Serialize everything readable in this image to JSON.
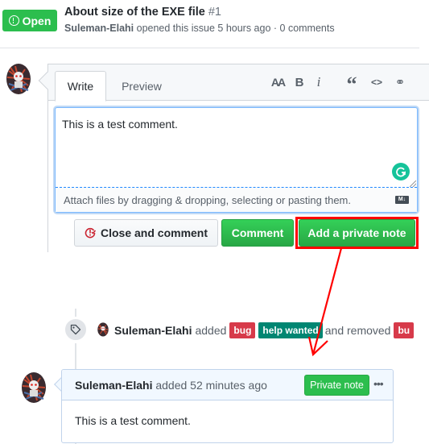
{
  "issue": {
    "state": "Open",
    "state_icon": "issue-opened-icon",
    "title": "About size of the EXE file",
    "number": "#1",
    "author": "Suleman-Elahi",
    "meta": "opened this issue 5 hours ago · 0 comments"
  },
  "comment_form": {
    "tabs": [
      {
        "label": "Write",
        "active": true
      },
      {
        "label": "Preview",
        "active": false
      }
    ],
    "toolbar": [
      {
        "icon": "text-size-icon",
        "glyph": "AA"
      },
      {
        "icon": "bold-icon",
        "glyph": "B"
      },
      {
        "icon": "italic-icon",
        "glyph": "i"
      },
      {
        "icon": "quote-icon",
        "glyph": "“"
      },
      {
        "icon": "code-icon",
        "glyph": "<>"
      },
      {
        "icon": "link-icon",
        "glyph": "⚭"
      }
    ],
    "textarea_value": "This is a test comment.",
    "attach_hint": "Attach files by dragging & dropping, selecting or pasting them.",
    "markdown_badge": "M↓",
    "buttons": {
      "close_and_comment": "Close and comment",
      "comment": "Comment",
      "add_private_note": "Add a private note"
    }
  },
  "timeline": {
    "event": {
      "icon": "tag-icon",
      "actor": "Suleman-Elahi",
      "action_added": "added",
      "labels_added": [
        {
          "name": "bug",
          "color": "#d73a4a"
        },
        {
          "name": "help wanted",
          "color": "#008672"
        }
      ],
      "action_removed": "and removed",
      "labels_removed": [
        {
          "name": "bu",
          "color": "#d73a4a"
        }
      ]
    },
    "private_comment": {
      "author": "Suleman-Elahi",
      "meta": "added 52 minutes ago",
      "badge": "Private note",
      "more_icon": "•••",
      "body": "This is a test comment."
    }
  },
  "annotation": {
    "highlight_color": "#ff0000",
    "target": "Add a private note"
  },
  "colors": {
    "open_green": "#2cbe4e",
    "button_green": "#28a745",
    "label_bug": "#d73a4a",
    "label_help_wanted": "#008672",
    "grammarly": "#15c39a"
  }
}
